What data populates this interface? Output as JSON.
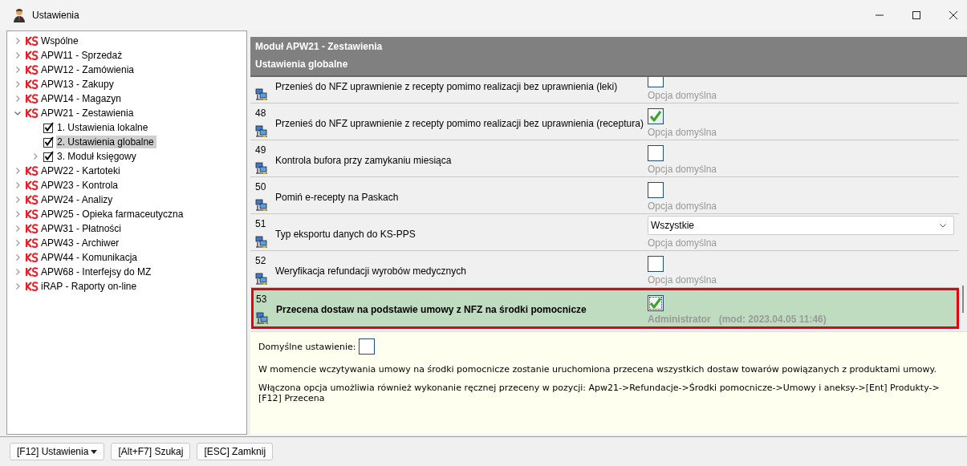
{
  "window": {
    "title": "Ustawienia"
  },
  "tree": [
    {
      "label": "Wspólne",
      "kind": "module",
      "expanded": false,
      "selected": false
    },
    {
      "label": "APW11 - Sprzedaż",
      "kind": "module",
      "expanded": false,
      "selected": false
    },
    {
      "label": "APW12 - Zamówienia",
      "kind": "module",
      "expanded": false,
      "selected": false
    },
    {
      "label": "APW13 - Zakupy",
      "kind": "module",
      "expanded": false,
      "selected": false
    },
    {
      "label": "APW14 - Magazyn",
      "kind": "module",
      "expanded": false,
      "selected": false
    },
    {
      "label": "APW21 - Zestawienia",
      "kind": "module",
      "expanded": true,
      "selected": false,
      "children": [
        {
          "label": "1. Ustawienia lokalne",
          "kind": "page",
          "selected": false
        },
        {
          "label": "2. Ustawienia globalne",
          "kind": "page",
          "selected": true
        },
        {
          "label": "3. Moduł księgowy",
          "kind": "page",
          "expanded": false,
          "selected": false
        }
      ]
    },
    {
      "label": "APW22 - Kartoteki",
      "kind": "module",
      "expanded": false,
      "selected": false
    },
    {
      "label": "APW23 - Kontrola",
      "kind": "module",
      "expanded": false,
      "selected": false
    },
    {
      "label": "APW24 - Analizy",
      "kind": "module",
      "expanded": false,
      "selected": false
    },
    {
      "label": "APW25 - Opieka farmaceutyczna",
      "kind": "module",
      "expanded": false,
      "selected": false
    },
    {
      "label": "APW31 - Płatności",
      "kind": "module",
      "expanded": false,
      "selected": false
    },
    {
      "label": "APW43 - Archiwer",
      "kind": "module",
      "expanded": false,
      "selected": false
    },
    {
      "label": "APW44 - Komunikacja",
      "kind": "module",
      "expanded": false,
      "selected": false
    },
    {
      "label": "APW68 - Interfejsy do MZ",
      "kind": "module",
      "expanded": false,
      "selected": false
    },
    {
      "label": "iRAP - Raporty on-line",
      "kind": "module",
      "expanded": false,
      "selected": false
    }
  ],
  "module_header": {
    "title": "Moduł APW21 - Zestawienia",
    "subtitle": "Ustawienia globalne"
  },
  "settings": [
    {
      "label": "Przenieś do NFZ uprawnienie z recepty pomimo realizacji bez uprawnienia (leki)",
      "kind": "checkbox",
      "note": "Opcja domyślna",
      "selected": false
    },
    {
      "number": "48",
      "label": "Przenieś do NFZ uprawnienie z recepty pomimo realizacji bez uprawnienia (receptura)",
      "kind": "checkbox",
      "checked": true,
      "note": "Opcja domyślna",
      "selected": false
    },
    {
      "number": "49",
      "label": "Kontrola bufora przy zamykaniu miesiąca",
      "kind": "checkbox",
      "checked": false,
      "note": "Opcja domyślna",
      "selected": false
    },
    {
      "number": "50",
      "label": "Pomiń e-recepty na Paskach",
      "kind": "checkbox",
      "checked": false,
      "note": "Opcja domyślna",
      "selected": false
    },
    {
      "number": "51",
      "label": "Typ eksportu danych do KS-PPS",
      "kind": "dropdown",
      "value": "Wszystkie",
      "note": "Opcja domyślna",
      "selected": false
    },
    {
      "number": "52",
      "label": "Weryfikacja refundacji wyrobów medycznych",
      "kind": "checkbox",
      "checked": false,
      "note": "Opcja domyślna",
      "selected": false
    },
    {
      "number": "53",
      "label": "Przecena dostaw na podstawie umowy z NFZ na środki pomocnicze",
      "kind": "checkbox",
      "checked": true,
      "note": "Administrator",
      "modified": "(mod: 2023.04.05 11:46)",
      "selected": true
    }
  ],
  "details": {
    "default_label": "Domyślne ustawienie:",
    "default_checked": false,
    "paragraphs": [
      "W momencie wczytywania umowy na środki pomocnicze zostanie uruchomiona przecena wszystkich dostaw towarów powiązanych z produktami umowy.",
      "Włączona opcja umożliwia również wykonanie ręcznej przeceny w pozycji: Apw21->Refundacje->Środki pomocnicze->Umowy i aneksy->[Ent] Produkty->[F12] Przecena"
    ]
  },
  "buttons": [
    {
      "label": "[F12] Ustawienia",
      "dropdown": true
    },
    {
      "label": "[Alt+F7] Szukaj",
      "dropdown": false
    },
    {
      "label": "[ESC] Zamknij",
      "dropdown": false
    }
  ]
}
